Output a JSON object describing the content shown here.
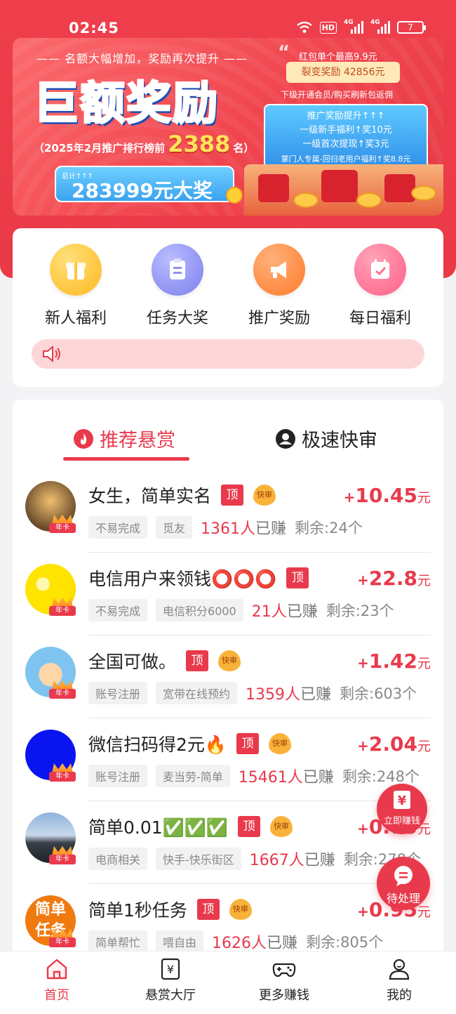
{
  "status_bar": {
    "time": "02:45",
    "hd": "HD",
    "network_4g": "4G",
    "battery": "7"
  },
  "banner": {
    "headline_top": "—— 名额大幅增加，奖励再次提升 ——",
    "title": "巨额奖励",
    "rank_prefix": "（2025年2月推广排行榜前",
    "rank_number": "2388",
    "rank_suffix": "名）",
    "total_label": "总计↑↑↑",
    "total_value": "283999元大奖",
    "right_line1": "红包单个最高9.9元",
    "right_box": "裂变奖励 42856元",
    "right_line2": "下级开通会员/购买刷新包返佣",
    "card_title": "推广奖励提升↑↑↑",
    "card_line1": "一级新手福利↑奖10元",
    "card_line2": "一级首次提现↑奖3元",
    "card_line3": "掌门人专属-回归老用户福利↑奖8.8元"
  },
  "quick_actions": [
    {
      "label": "新人福利",
      "icon": "gift-box-icon",
      "color": "#ffc53d"
    },
    {
      "label": "任务大奖",
      "icon": "task-list-icon",
      "color": "#8b8ff3"
    },
    {
      "label": "推广奖励",
      "icon": "megaphone-icon",
      "color": "#ff8a3d"
    },
    {
      "label": "每日福利",
      "icon": "calendar-check-icon",
      "color": "#ff6f8e"
    }
  ],
  "notice": {
    "icon": "speaker-icon",
    "text": ""
  },
  "tabs": [
    {
      "label": "推荐悬赏",
      "icon": "flame-icon",
      "active": true
    },
    {
      "label": "极速快审",
      "icon": "user-badge-icon",
      "active": false
    }
  ],
  "tasks": [
    {
      "title": "女生，简单实名",
      "emoji": "",
      "top_badge": "顶",
      "fast_badge": "快审",
      "price_prefix": "+",
      "price": "10.45",
      "unit": "元",
      "tags": [
        "不易完成",
        "觅友"
      ],
      "earned_count": "1361人",
      "earned_suffix": "已赚",
      "remaining": "剩余:24个",
      "avatar": "tiger-avatar",
      "vip": "年卡"
    },
    {
      "title": "电信用户来领钱⭕⭕⭕",
      "emoji": "",
      "top_badge": "顶",
      "fast_badge": "",
      "price_prefix": "+",
      "price": "22.8",
      "unit": "元",
      "tags": [
        "不易完成",
        "电信积分6000"
      ],
      "earned_count": "21人",
      "earned_suffix": "已赚",
      "remaining": "剩余:23个",
      "avatar": "sun-avatar",
      "vip": "年卡"
    },
    {
      "title": "全国可做。",
      "emoji": "",
      "top_badge": "顶",
      "fast_badge": "快审",
      "price_prefix": "+",
      "price": "1.42",
      "unit": "元",
      "tags": [
        "账号注册",
        "宽带在线预约"
      ],
      "earned_count": "1359人",
      "earned_suffix": "已赚",
      "remaining": "剩余:603个",
      "avatar": "cartoon-avatar",
      "vip": "年卡"
    },
    {
      "title": "微信扫码得2元🔥",
      "emoji": "",
      "top_badge": "顶",
      "fast_badge": "快审",
      "price_prefix": "+",
      "price": "2.04",
      "unit": "元",
      "tags": [
        "账号注册",
        "麦当劳-简单"
      ],
      "earned_count": "15461人",
      "earned_suffix": "已赚",
      "remaining": "剩余:248个",
      "avatar": "blue-avatar",
      "vip": "年卡"
    },
    {
      "title": "简单0.01✅✅✅",
      "emoji": "",
      "top_badge": "顶",
      "fast_badge": "快审",
      "price_prefix": "+",
      "price": "0.75",
      "unit": "元",
      "tags": [
        "电商相关",
        "快手-快乐街区"
      ],
      "earned_count": "1667人",
      "earned_suffix": "已赚",
      "remaining": "剩余:278个",
      "avatar": "landscape-avatar",
      "vip": "年卡"
    },
    {
      "title": "简单1秒任务",
      "emoji": "",
      "top_badge": "顶",
      "fast_badge": "快审",
      "price_prefix": "+",
      "price": "0.95",
      "unit": "元",
      "tags": [
        "简单帮忙",
        "喂自由"
      ],
      "earned_count": "1626人",
      "earned_suffix": "已赚",
      "remaining": "剩余:805个",
      "avatar": "text-avatar",
      "avatar_text": "简单任务",
      "vip": "年卡"
    }
  ],
  "floating": {
    "earn_now": {
      "icon": "yuan-icon",
      "label": "立即赚钱"
    },
    "pending": {
      "icon": "chat-bubble-icon",
      "label": "待处理"
    }
  },
  "bottom_nav": [
    {
      "label": "首页",
      "icon": "home-icon",
      "active": true
    },
    {
      "label": "悬赏大厅",
      "icon": "yuan-doc-icon",
      "active": false
    },
    {
      "label": "更多赚钱",
      "icon": "gamepad-icon",
      "active": false
    },
    {
      "label": "我的",
      "icon": "person-icon",
      "active": false
    }
  ],
  "colors": {
    "primary": "#e83a4c",
    "header_bg": "#ee3e4c",
    "page_bg": "#f3f3f6"
  }
}
